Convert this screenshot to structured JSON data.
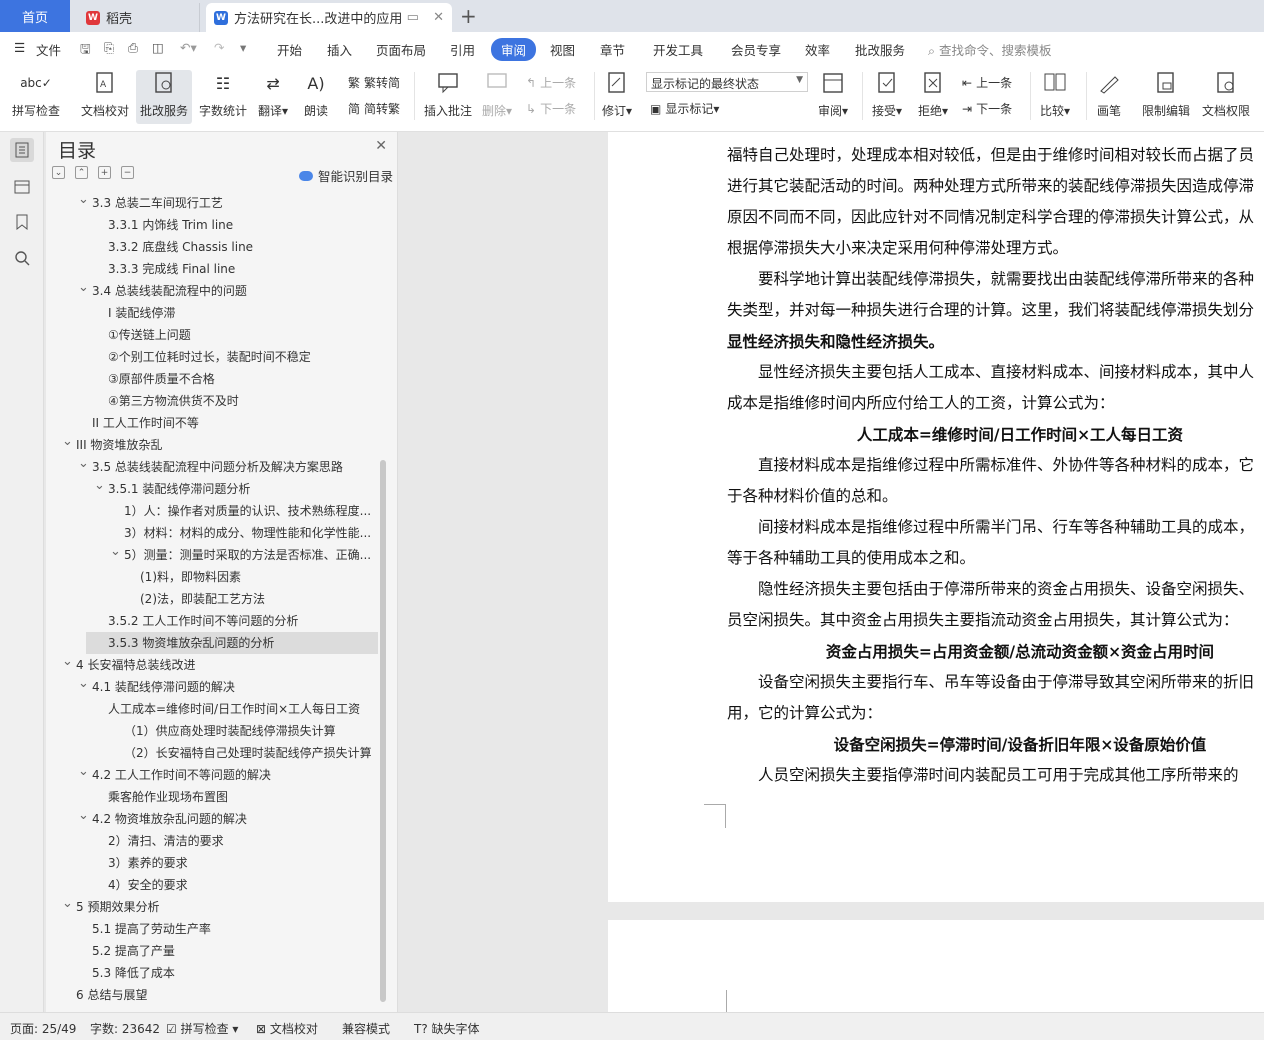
{
  "tabs": {
    "home": "首页",
    "wps": "稻壳",
    "doc": "方法研究在长...改进中的应用"
  },
  "menu": {
    "file": "文件",
    "items": [
      "开始",
      "插入",
      "页面布局",
      "引用",
      "审阅",
      "视图",
      "章节",
      "开发工具",
      "会员专享",
      "效率",
      "批改服务"
    ],
    "active": "审阅",
    "search": "查找命令、搜索模板"
  },
  "ribbon": {
    "spell": "拼写检查",
    "proof": "文档校对",
    "correct": "批改服务",
    "wordcount": "字数统计",
    "translate": "翻译",
    "read": "朗读",
    "trad2simp": "繁转简",
    "simp2trad": "简转繁",
    "insert_comment": "插入批注",
    "delete": "删除",
    "prev_comment": "上一条",
    "next_comment": "下一条",
    "revise": "修订",
    "markup_state": "显示标记的最终状态",
    "show_markup": "显示标记",
    "review": "审阅",
    "accept": "接受",
    "reject": "拒绝",
    "prev": "上一条",
    "next": "下一条",
    "compare": "比较",
    "pen": "画笔",
    "restrict": "限制编辑",
    "permission": "文档权限"
  },
  "toc": {
    "title": "目录",
    "smart": "智能识别目录",
    "items": [
      {
        "text": "3.3 总装二车间现行工艺",
        "level": 1,
        "chev": "v"
      },
      {
        "text": "3.3.1 内饰线  Trim line",
        "level": 2,
        "chev": ""
      },
      {
        "text": "3.3.2 底盘线  Chassis line",
        "level": 2,
        "chev": ""
      },
      {
        "text": "3.3.3 完成线  Final line",
        "level": 2,
        "chev": ""
      },
      {
        "text": "3.4 总装线装配流程中的问题",
        "level": 1,
        "chev": "v"
      },
      {
        "text": "I 装配线停滞",
        "level": 2,
        "chev": ""
      },
      {
        "text": "①传送链上问题",
        "level": 2,
        "chev": ""
      },
      {
        "text": "②个别工位耗时过长，装配时间不稳定",
        "level": 2,
        "chev": ""
      },
      {
        "text": "③原部件质量不合格",
        "level": 2,
        "chev": ""
      },
      {
        "text": "④第三方物流供货不及时",
        "level": 2,
        "chev": ""
      },
      {
        "text": "II 工人工作时间不等",
        "level": 1,
        "chev": ""
      },
      {
        "text": "III 物资堆放杂乱",
        "level": 0,
        "chev": "v"
      },
      {
        "text": "3.5 总装线装配流程中问题分析及解决方案思路",
        "level": 1,
        "chev": "v"
      },
      {
        "text": "3.5.1 装配线停滞问题分析",
        "level": 2,
        "chev": "v"
      },
      {
        "text": "1）人：操作者对质量的认识、技术熟练程度...",
        "level": 3,
        "chev": ""
      },
      {
        "text": "3）材料：材料的成分、物理性能和化学性能...",
        "level": 3,
        "chev": ""
      },
      {
        "text": "5）测量：测量时采取的方法是否标准、正确...",
        "level": 3,
        "chev": "v"
      },
      {
        "text": "(1)料，即物料因素",
        "level": 4,
        "chev": ""
      },
      {
        "text": "(2)法，即装配工艺方法",
        "level": 4,
        "chev": ""
      },
      {
        "text": "3.5.2 工人工作时间不等问题的分析",
        "level": 2,
        "chev": ""
      },
      {
        "text": "3.5.3 物资堆放杂乱问题的分析",
        "level": 2,
        "chev": "",
        "selected": true
      },
      {
        "text": "4  长安福特总装线改进",
        "level": 0,
        "chev": "v"
      },
      {
        "text": "4.1 装配线停滞问题的解决",
        "level": 1,
        "chev": "v"
      },
      {
        "text": "人工成本=维修时间/日工作时间×工人每日工资",
        "level": 2,
        "chev": ""
      },
      {
        "text": "（1）供应商处理时装配线停滞损失计算",
        "level": 3,
        "chev": ""
      },
      {
        "text": "（2）长安福特自己处理时装配线停产损失计算",
        "level": 3,
        "chev": ""
      },
      {
        "text": "4.2 工人工作时间不等问题的解决",
        "level": 1,
        "chev": "v"
      },
      {
        "text": "乘客舱作业现场布置图",
        "level": 2,
        "chev": ""
      },
      {
        "text": "4.2 物资堆放杂乱问题的解决",
        "level": 1,
        "chev": "v"
      },
      {
        "text": "2）清扫、清洁的要求",
        "level": 2,
        "chev": ""
      },
      {
        "text": "3）素养的要求",
        "level": 2,
        "chev": ""
      },
      {
        "text": "4）安全的要求",
        "level": 2,
        "chev": ""
      },
      {
        "text": "5  预期效果分析",
        "level": 0,
        "chev": "v"
      },
      {
        "text": "5.1 提高了劳动生产率",
        "level": 1,
        "chev": ""
      },
      {
        "text": "5.2 提高了产量",
        "level": 1,
        "chev": ""
      },
      {
        "text": "5.3 降低了成本",
        "level": 1,
        "chev": ""
      },
      {
        "text": "6  总结与展望",
        "level": 0,
        "chev": ""
      }
    ]
  },
  "document": {
    "lines": [
      {
        "text": "福特自己处理时，处理成本相对较低，但是由于维修时间相对较长而占据了员",
        "type": "normal"
      },
      {
        "text": "进行其它装配活动的时间。两种处理方式所带来的装配线停滞损失因造成停滞",
        "type": "normal"
      },
      {
        "text": "原因不同而不同，因此应针对不同情况制定科学合理的停滞损失计算公式，从",
        "type": "normal"
      },
      {
        "text": "根据停滞损失大小来决定采用何种停滞处理方式。",
        "type": "normal"
      },
      {
        "text": "　　要科学地计算出装配线停滞损失，就需要找出由装配线停滞所带来的各种",
        "type": "normal"
      },
      {
        "text": "失类型，并对每一种损失进行合理的计算。这里，我们将装配线停滞损失划分",
        "type": "normal"
      },
      {
        "text": "显性经济损失和隐性经济损失。",
        "type": "boldmix"
      },
      {
        "text": "　　显性经济损失主要包括人工成本、直接材料成本、间接材料成本，其中人",
        "type": "normal"
      },
      {
        "text": "成本是指维修时间内所应付给工人的工资，计算公式为：",
        "type": "normal"
      },
      {
        "text": "人工成本=维修时间/日工作时间×工人每日工资",
        "type": "center"
      },
      {
        "text": "　　直接材料成本是指维修过程中所需标准件、外协件等各种材料的成本，它",
        "type": "normal"
      },
      {
        "text": "于各种材料价值的总和。",
        "type": "normal"
      },
      {
        "text": "　　间接材料成本是指维修过程中所需半门吊、行车等各种辅助工具的成本，",
        "type": "normal"
      },
      {
        "text": "等于各种辅助工具的使用成本之和。",
        "type": "normal"
      },
      {
        "text": "　　隐性经济损失主要包括由于停滞所带来的资金占用损失、设备空闲损失、",
        "type": "normal"
      },
      {
        "text": "员空闲损失。其中资金占用损失主要指流动资金占用损失，其计算公式为：",
        "type": "normal"
      },
      {
        "text": "资金占用损失=占用资金额/总流动资金额×资金占用时间",
        "type": "center"
      },
      {
        "text": "　　设备空闲损失主要指行车、吊车等设备由于停滞导致其空闲所带来的折旧",
        "type": "normal"
      },
      {
        "text": "用，它的计算公式为：",
        "type": "normal"
      },
      {
        "text": "设备空闲损失=停滞时间/设备折旧年限×设备原始价值",
        "type": "center"
      },
      {
        "text": "　　人员空闲损失主要指停滞时间内装配员工可用于完成其他工序所带来的",
        "type": "normal"
      }
    ]
  },
  "status": {
    "page": "页面: 25/49",
    "words": "字数: 23642",
    "spell": "拼写检查",
    "proof": "文档校对",
    "compat": "兼容模式",
    "missing_font": "缺失字体"
  }
}
